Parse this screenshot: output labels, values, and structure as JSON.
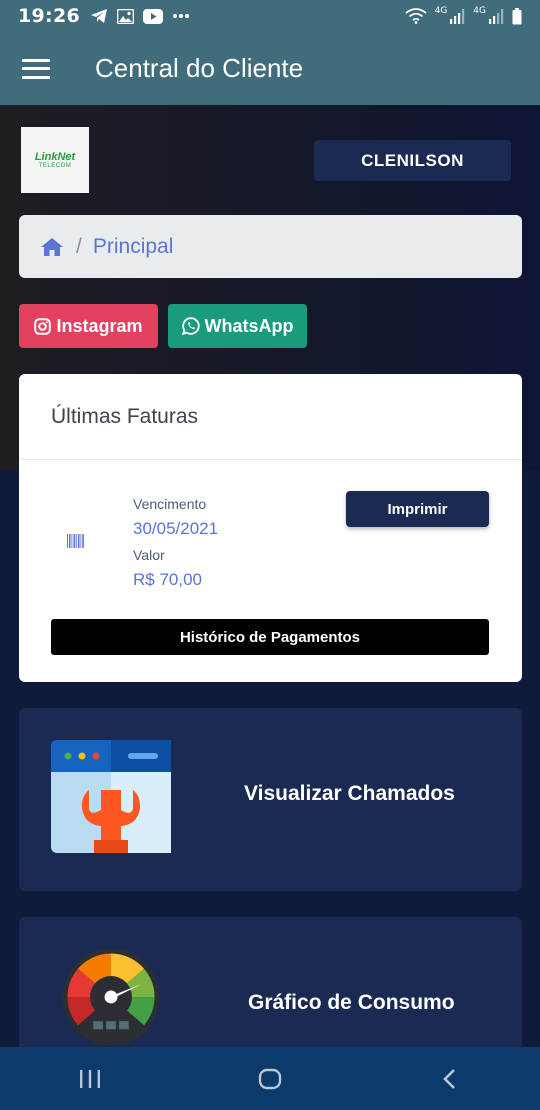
{
  "status_bar": {
    "time": "19:26",
    "network_1": "4G",
    "network_2": "4G",
    "icons": [
      "telegram-icon",
      "gallery-icon",
      "youtube-icon",
      "more-icon",
      "wifi-icon",
      "signal-icon",
      "battery-icon"
    ]
  },
  "app_bar": {
    "title": "Central do Cliente",
    "menu_icon": "menu-icon"
  },
  "header": {
    "logo_text": "LinkNet",
    "logo_subtext": "TELECOM",
    "user_name": "CLENILSON"
  },
  "breadcrumb": {
    "home_icon": "home-icon",
    "separator": "/",
    "current": "Principal"
  },
  "social": {
    "instagram": {
      "label": "Instagram",
      "color": "#e4405f"
    },
    "whatsapp": {
      "label": "WhatsApp",
      "color": "#1a9b7c"
    }
  },
  "invoices": {
    "title": "Últimas Faturas",
    "due_label": "Vencimento",
    "due_date": "30/05/2021",
    "value_label": "Valor",
    "value": "R$ 70,00",
    "print_label": "Imprimir",
    "history_label": "Histórico de Pagamentos"
  },
  "tiles": [
    {
      "label": "Visualizar Chamados",
      "icon": "support-wrench-icon"
    },
    {
      "label": "Gráfico de Consumo",
      "icon": "speedometer-icon"
    }
  ],
  "nav": {
    "recent": "recent-apps-icon",
    "home": "home-button-icon",
    "back": "back-icon"
  },
  "colors": {
    "app_bar": "#416c7c",
    "primary_dark": "#1a2a52",
    "accent_link": "#5a75d6",
    "background": "#0f1a3c"
  }
}
